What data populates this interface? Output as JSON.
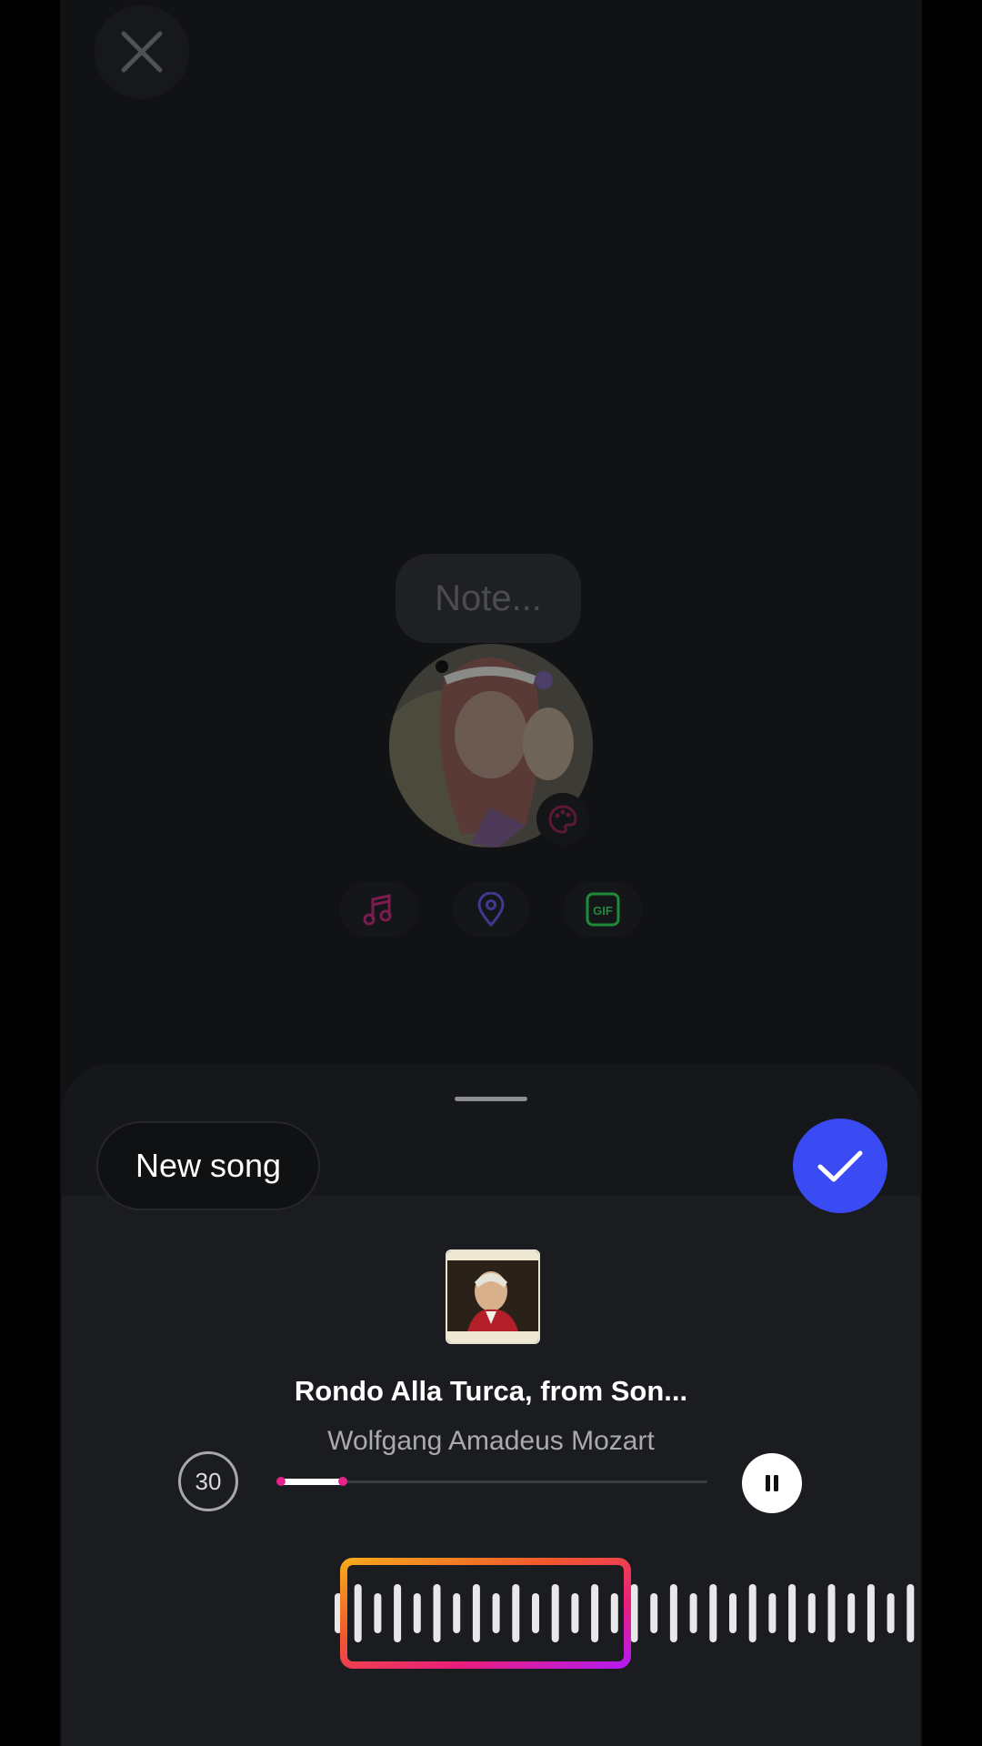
{
  "note": {
    "placeholder": "Note..."
  },
  "chips": [
    {
      "icon": "music-note-icon",
      "color": "#7b1c4f"
    },
    {
      "icon": "location-pin-icon",
      "color": "#3f3a8f"
    },
    {
      "icon": "gif-icon",
      "label": "GIF",
      "color": "#1f8a3a"
    }
  ],
  "sheet": {
    "new_song_label": "New song",
    "song": {
      "title": "Rondo Alla Turca, from Son...",
      "artist": "Wolfgang Amadeus Mozart"
    },
    "clip_duration": "30",
    "playback_progress": 0.15,
    "playing": true,
    "confirm_color": "#3b4bf3"
  },
  "colors": {
    "background": "#111214",
    "sheet": "#1b1c20",
    "selection_gradient": [
      "#f6a81b",
      "#f25a2c",
      "#ea1e7b",
      "#b41bf0"
    ]
  }
}
